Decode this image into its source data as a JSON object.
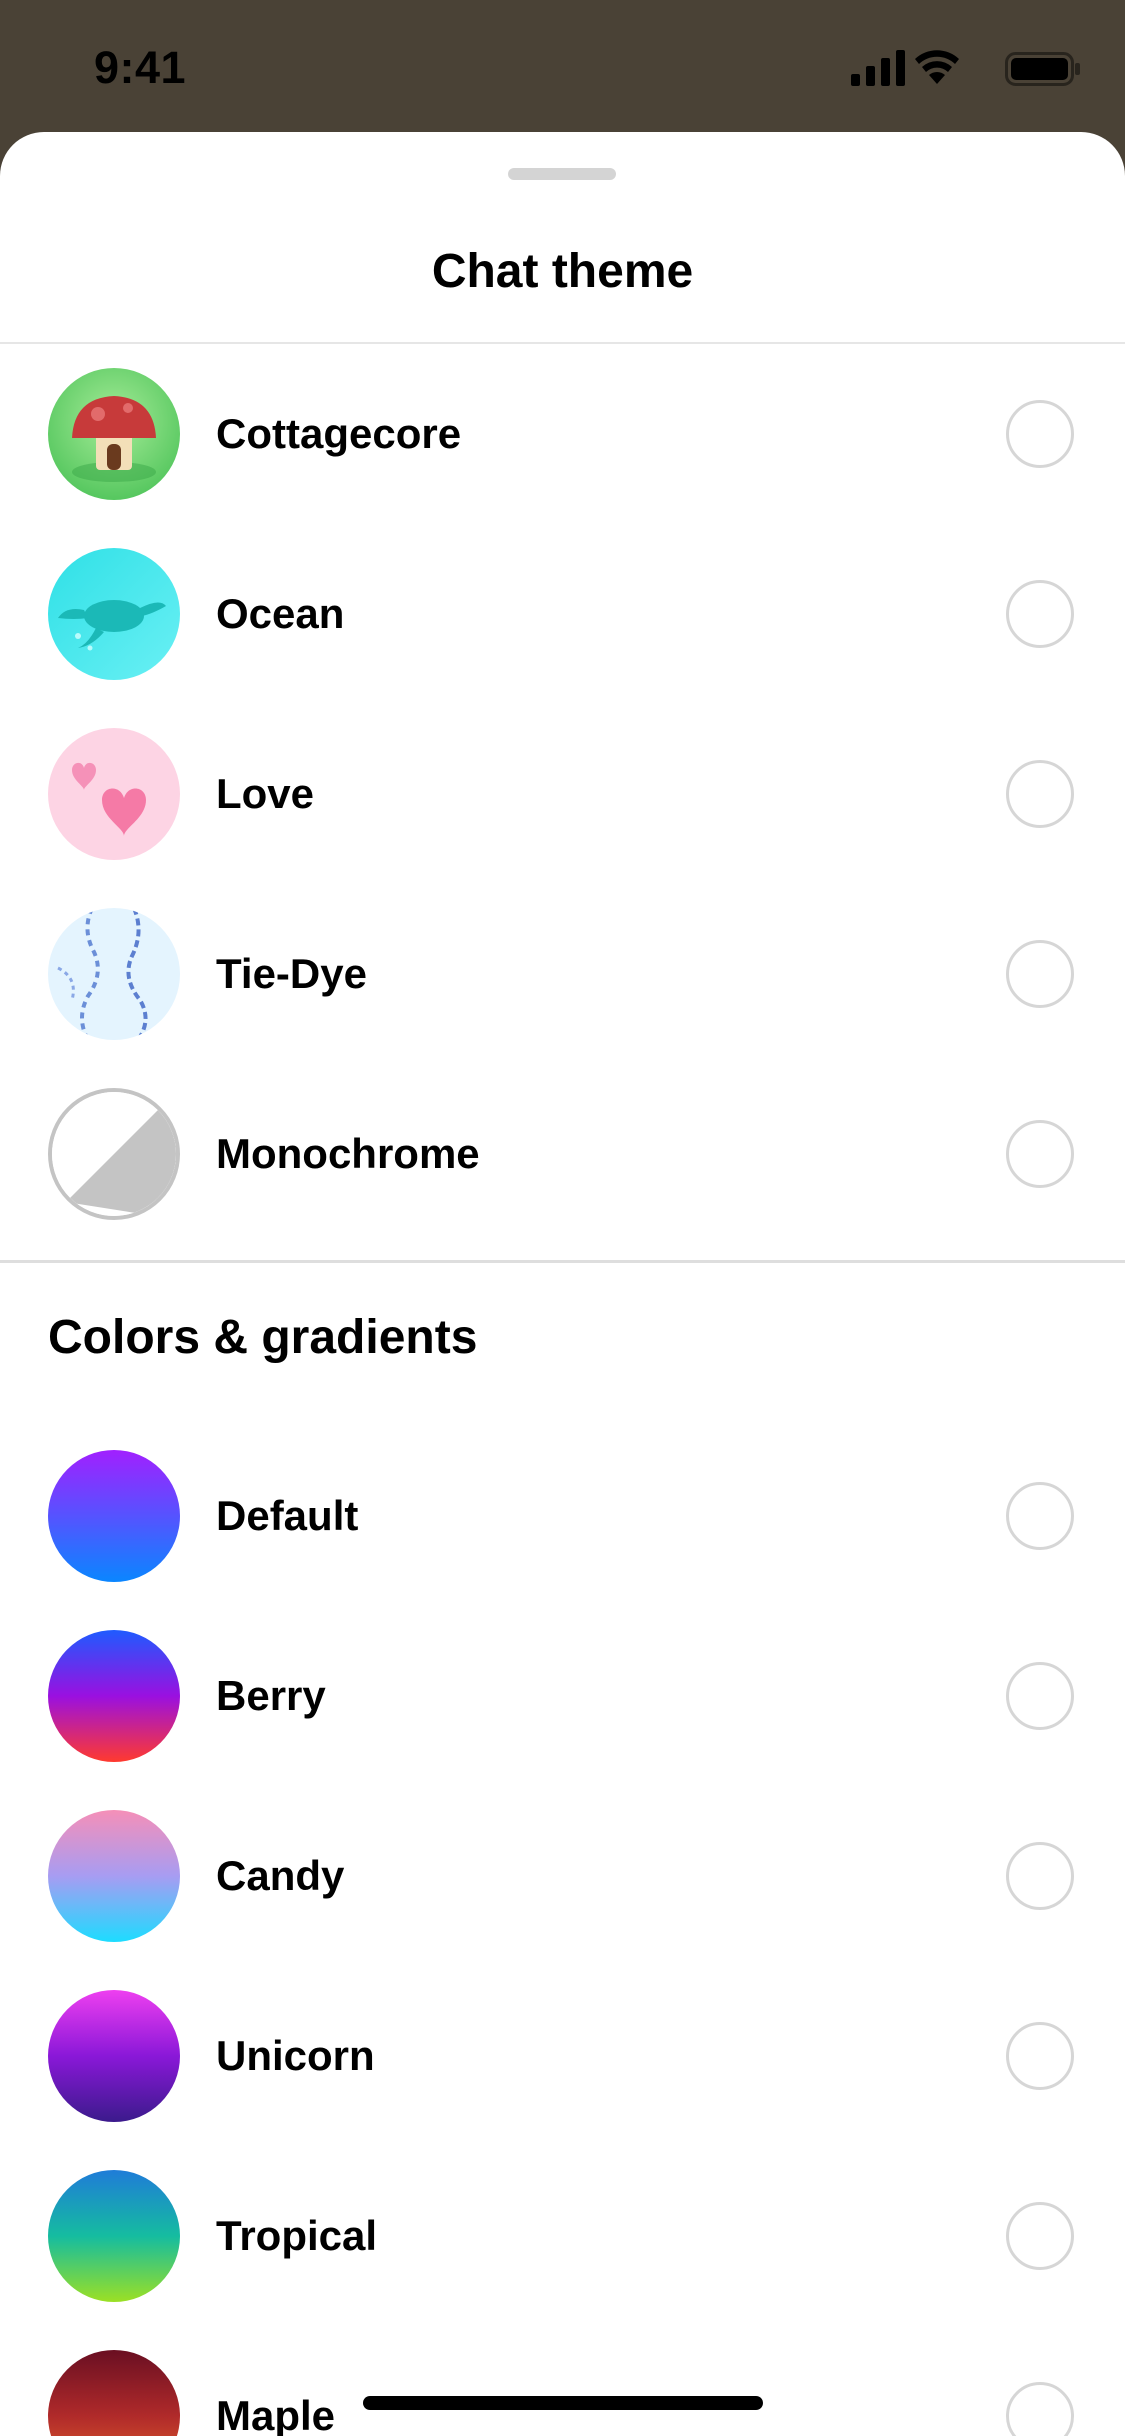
{
  "status_bar": {
    "time": "9:41"
  },
  "sheet": {
    "title": "Chat theme"
  },
  "themes": [
    {
      "label": "Cottagecore",
      "icon": "mushroom-house-icon"
    },
    {
      "label": "Ocean",
      "icon": "sea-turtle-icon"
    },
    {
      "label": "Love",
      "icon": "hearts-icon"
    },
    {
      "label": "Tie-Dye",
      "icon": "tie-dye-pattern-icon"
    },
    {
      "label": "Monochrome",
      "icon": "half-gray-circle-icon"
    }
  ],
  "colors_section": {
    "title": "Colors & gradients",
    "items": [
      {
        "label": "Default",
        "colors": [
          "#a120ff",
          "#0a86ff"
        ]
      },
      {
        "label": "Berry",
        "colors": [
          "#1f5bff",
          "#9a10e0",
          "#ff3a2e"
        ]
      },
      {
        "label": "Candy",
        "colors": [
          "#f58fb8",
          "#a79cf2",
          "#1ddcff"
        ]
      },
      {
        "label": "Unicorn",
        "colors": [
          "#ee3ff0",
          "#8a18d8",
          "#3b1a8c"
        ]
      },
      {
        "label": "Tropical",
        "colors": [
          "#1f7cd8",
          "#15bca0",
          "#9be024"
        ]
      },
      {
        "label": "Maple",
        "colors": [
          "#6a0f22",
          "#b02a2a",
          "#e96a2a"
        ]
      }
    ]
  }
}
